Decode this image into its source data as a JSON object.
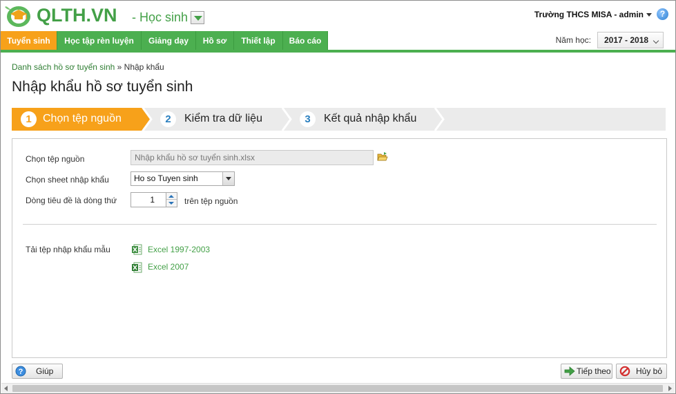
{
  "header": {
    "brand": "QLTH.VN",
    "role": "- Học sinh",
    "school_user": "Trường THCS MISA - admin",
    "help_symbol": "?"
  },
  "nav": {
    "items": [
      {
        "label": "Tuyển sinh",
        "active": true
      },
      {
        "label": "Học tập rèn luyện",
        "active": false
      },
      {
        "label": "Giảng dạy",
        "active": false
      },
      {
        "label": "Hồ sơ",
        "active": false
      },
      {
        "label": "Thiết lập",
        "active": false
      },
      {
        "label": "Báo cáo",
        "active": false
      }
    ],
    "year_label": "Năm học:",
    "year_value": "2017 - 2018"
  },
  "breadcrumb": {
    "link": "Danh sách hồ sơ tuyển sinh",
    "separator": "»",
    "current": "Nhập khẩu"
  },
  "page_title": "Nhập khẩu hồ sơ tuyển sinh",
  "steps": [
    {
      "number": "1",
      "label": "Chọn tệp nguồn",
      "active": true
    },
    {
      "number": "2",
      "label": "Kiểm tra dữ liệu",
      "active": false
    },
    {
      "number": "3",
      "label": "Kết quả nhập khẩu",
      "active": false
    }
  ],
  "form": {
    "source_label": "Chọn tệp nguồn",
    "source_value": "Nhập khẩu hồ sơ tuyển sinh.xlsx",
    "sheet_label": "Chọn sheet nhập khẩu",
    "sheet_value": "Ho so Tuyen sinh",
    "header_row_label": "Dòng tiêu đề là dòng thứ",
    "header_row_value": "1",
    "header_row_suffix": "trên tệp nguồn",
    "template_label": "Tải tệp nhập khẩu mẫu",
    "template_links": [
      "Excel 1997-2003",
      "Excel 2007"
    ]
  },
  "footer": {
    "help_label": "Giúp",
    "next_label": "Tiếp theo",
    "cancel_label": "Hủy bỏ"
  },
  "colors": {
    "brand_green": "#43a047",
    "nav_green": "#4caf50",
    "active_orange": "#f7a11a",
    "step_inactive": "#ebebeb"
  },
  "icons": {
    "logo": "graduation-leaf-logo",
    "folder": "folder-open-icon",
    "excel": "excel-file-icon",
    "help": "help-icon",
    "next": "arrow-right-icon",
    "cancel": "cancel-icon"
  }
}
